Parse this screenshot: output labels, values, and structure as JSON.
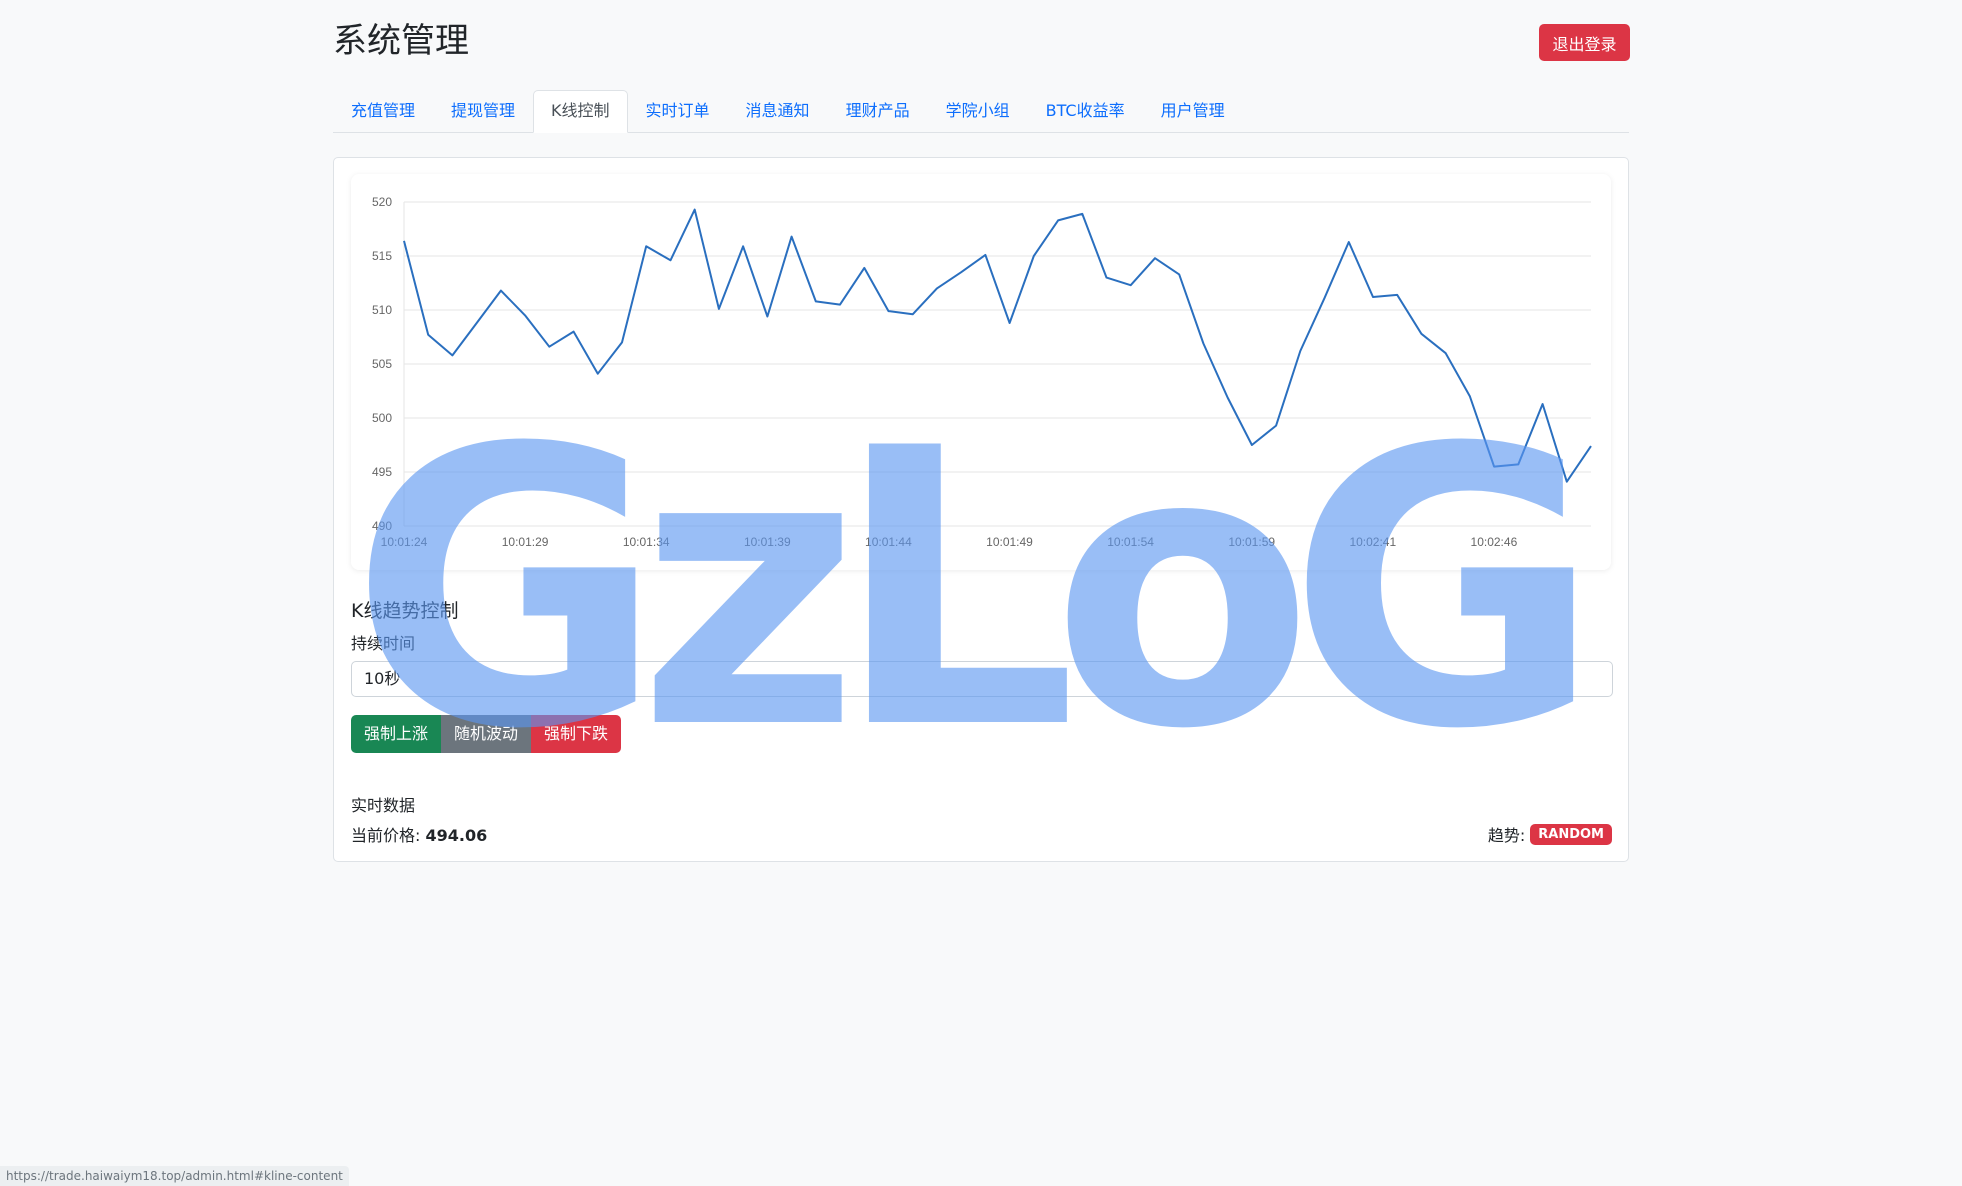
{
  "header": {
    "title": "系统管理",
    "logout_label": "退出登录"
  },
  "tabs": [
    {
      "label": "充值管理",
      "active": false
    },
    {
      "label": "提现管理",
      "active": false
    },
    {
      "label": "K线控制",
      "active": true
    },
    {
      "label": "实时订单",
      "active": false
    },
    {
      "label": "消息通知",
      "active": false
    },
    {
      "label": "理财产品",
      "active": false
    },
    {
      "label": "学院小组",
      "active": false
    },
    {
      "label": "BTC收益率",
      "active": false
    },
    {
      "label": "用户管理",
      "active": false
    }
  ],
  "chart_data": {
    "type": "line",
    "ylim": [
      490,
      520
    ],
    "yticks": [
      520,
      515,
      510,
      505,
      500,
      495,
      490
    ],
    "x_tick_labels": [
      "10:01:24",
      "10:01:29",
      "10:01:34",
      "10:01:39",
      "10:01:44",
      "10:01:49",
      "10:01:54",
      "10:01:59",
      "10:02:41",
      "10:02:46"
    ],
    "line_color": "#2a6fbf",
    "grid": true,
    "series": [
      {
        "values": [
          516.4,
          507.7,
          505.8,
          508.8,
          511.8,
          509.5,
          506.6,
          508.0,
          504.1,
          507.0,
          515.9,
          514.6,
          519.3,
          510.1,
          515.9,
          509.4,
          516.8,
          510.8,
          510.5,
          513.9,
          509.9,
          509.6,
          512.0,
          513.5,
          515.1,
          508.8,
          515.0,
          518.3,
          518.9,
          513.0,
          512.3,
          514.8,
          513.3,
          506.9,
          501.9,
          497.5,
          499.3,
          506.2,
          511.1,
          516.3,
          511.2,
          511.4,
          507.8,
          506.0,
          502.0,
          495.5,
          495.7,
          501.3,
          494.1,
          497.4
        ]
      }
    ]
  },
  "control": {
    "section_title": "K线趋势控制",
    "duration_label": "持续时间",
    "duration_value": "10秒",
    "btn_up": "强制上涨",
    "btn_random": "随机波动",
    "btn_down": "强制下跌"
  },
  "realtime": {
    "title": "实时数据",
    "price_label": "当前价格:",
    "price_value": "494.06",
    "trend_label": "趋势:",
    "trend_badge": "RANDOM"
  },
  "watermark": "GzLoG",
  "status_url": "https://trade.haiwaiym18.top/admin.html#kline-content"
}
